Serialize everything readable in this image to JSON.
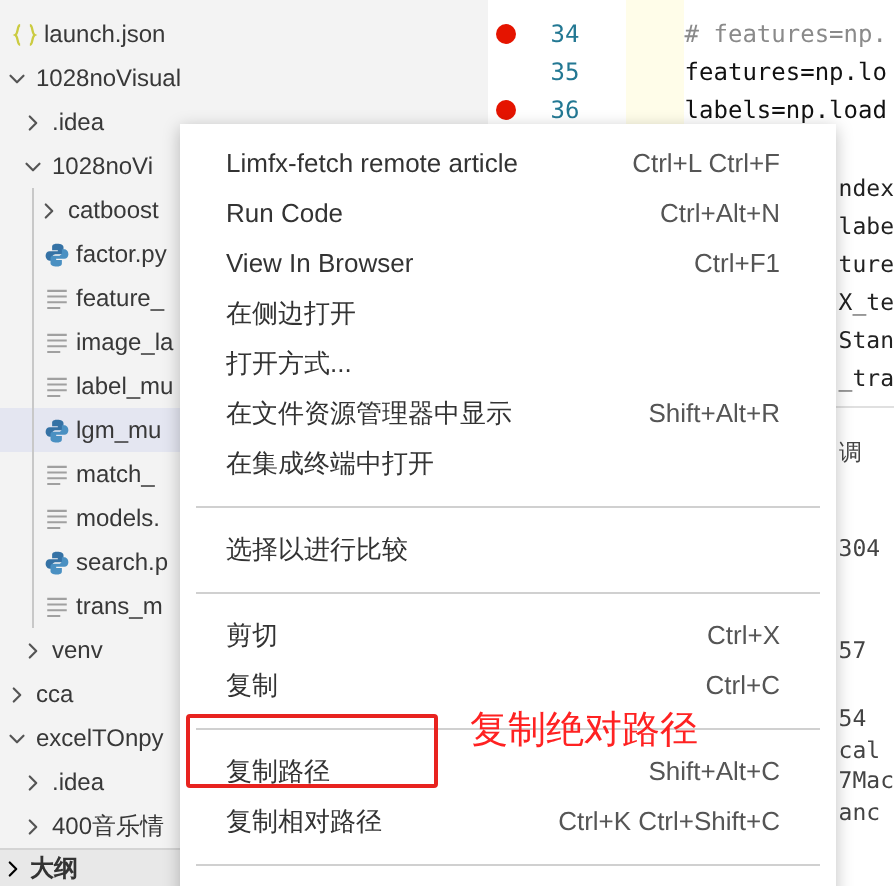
{
  "explorer": {
    "tree": [
      {
        "label": "launch.json",
        "kind": "json",
        "selected": false
      },
      {
        "label": "1028noVisual",
        "kind": "folder",
        "expanded": true,
        "selected": false,
        "children": [
          {
            "label": ".idea",
            "kind": "folder",
            "expanded": false,
            "selected": false
          },
          {
            "label": "1028noVi",
            "kind": "folder",
            "expanded": true,
            "selected": false,
            "children": [
              {
                "label": "catboost",
                "kind": "folder",
                "expanded": false,
                "selected": false
              },
              {
                "label": "factor.py",
                "kind": "python",
                "selected": false
              },
              {
                "label": "feature_",
                "kind": "text",
                "selected": false
              },
              {
                "label": "image_la",
                "kind": "text",
                "selected": false
              },
              {
                "label": "label_mu",
                "kind": "text",
                "selected": false
              },
              {
                "label": "lgm_mu",
                "kind": "python",
                "selected": true
              },
              {
                "label": "match_",
                "kind": "text",
                "selected": false
              },
              {
                "label": "models.",
                "kind": "text",
                "selected": false
              },
              {
                "label": "search.p",
                "kind": "python",
                "selected": false
              },
              {
                "label": "trans_m",
                "kind": "text",
                "selected": false
              }
            ]
          },
          {
            "label": "venv",
            "kind": "folder",
            "expanded": false,
            "selected": false
          }
        ]
      },
      {
        "label": "cca",
        "kind": "folder",
        "expanded": false,
        "selected": false
      },
      {
        "label": "excelTOnpy",
        "kind": "folder",
        "expanded": true,
        "selected": false,
        "children": [
          {
            "label": ".idea",
            "kind": "folder",
            "expanded": false,
            "selected": false
          },
          {
            "label": "400音乐情",
            "kind": "folder",
            "expanded": false,
            "selected": false
          }
        ]
      }
    ],
    "outline": {
      "label": "大纲",
      "expanded": false
    }
  },
  "editor": {
    "lines": [
      {
        "number": "34",
        "breakpoint": true,
        "code": "# features=np.",
        "kind": "comment"
      },
      {
        "number": "35",
        "breakpoint": false,
        "code": "features=np.lo",
        "kind": "code"
      },
      {
        "number": "36",
        "breakpoint": true,
        "code": "labels=np.load",
        "kind": "code"
      }
    ],
    "visible_code": [
      "ndex",
      "labe",
      "ture",
      "X_te",
      "Stan",
      "_tra"
    ],
    "panel_text": [
      {
        "text": "调",
        "kind": "ui"
      },
      {
        "text": "304",
        "kind": "output"
      },
      {
        "text": "57",
        "kind": "output"
      },
      {
        "text": "54",
        "kind": "output"
      },
      {
        "text": "cal",
        "kind": "output"
      },
      {
        "text": "7Mac",
        "kind": "output"
      },
      {
        "text": "anc",
        "kind": "output"
      }
    ]
  },
  "context_menu": {
    "items": [
      {
        "kind": "item",
        "label": "Limfx-fetch remote article",
        "shortcut": "Ctrl+L Ctrl+F",
        "highlighted": false
      },
      {
        "kind": "item",
        "label": "Run Code",
        "shortcut": "Ctrl+Alt+N",
        "highlighted": false
      },
      {
        "kind": "item",
        "label": "View In Browser",
        "shortcut": "Ctrl+F1",
        "highlighted": false
      },
      {
        "kind": "item",
        "label": "在侧边打开",
        "highlighted": false
      },
      {
        "kind": "item",
        "label": "打开方式...",
        "highlighted": false
      },
      {
        "kind": "item",
        "label": "在文件资源管理器中显示",
        "shortcut": "Shift+Alt+R",
        "highlighted": false
      },
      {
        "kind": "item",
        "label": "在集成终端中打开",
        "highlighted": false
      },
      {
        "kind": "separator"
      },
      {
        "kind": "item",
        "label": "选择以进行比较",
        "highlighted": false
      },
      {
        "kind": "separator"
      },
      {
        "kind": "item",
        "label": "剪切",
        "shortcut": "Ctrl+X",
        "highlighted": false
      },
      {
        "kind": "item",
        "label": "复制",
        "shortcut": "Ctrl+C",
        "highlighted": false
      },
      {
        "kind": "separator"
      },
      {
        "kind": "item",
        "label": "复制路径",
        "shortcut": "Shift+Alt+C",
        "highlighted": true
      },
      {
        "kind": "item",
        "label": "复制相对路径",
        "shortcut": "Ctrl+K Ctrl+Shift+C",
        "highlighted": false
      },
      {
        "kind": "separator"
      }
    ]
  },
  "annotation": {
    "text": "复制绝对路径"
  }
}
